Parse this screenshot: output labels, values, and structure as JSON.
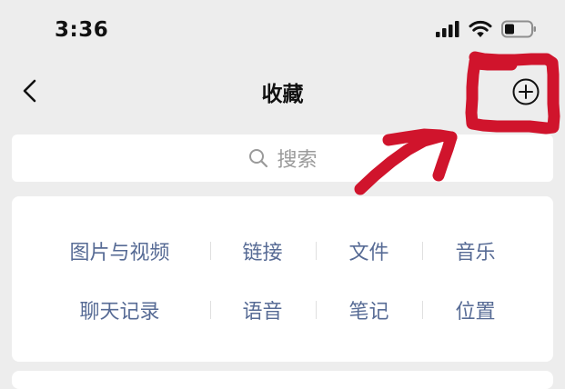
{
  "status_bar": {
    "time": "3:36",
    "icons": [
      "cellular-signal-icon",
      "wifi-icon",
      "battery-icon"
    ]
  },
  "nav": {
    "title": "收藏",
    "back_icon": "chevron-left-icon",
    "add_icon": "circle-plus-icon"
  },
  "search": {
    "placeholder": "搜索",
    "icon": "search-icon"
  },
  "categories": {
    "row1": [
      "图片与视频",
      "链接",
      "文件",
      "音乐"
    ],
    "row2": [
      "聊天记录",
      "语音",
      "笔记",
      "位置"
    ]
  },
  "colors": {
    "background": "#ededed",
    "card": "#ffffff",
    "category_text": "#576b95",
    "placeholder": "#9a9a9a",
    "annotation": "#d0142c"
  }
}
